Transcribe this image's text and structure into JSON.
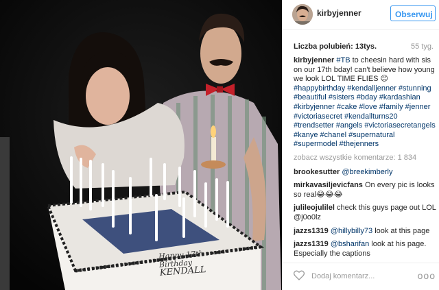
{
  "header": {
    "username": "kirbyjenner",
    "follow_label": "Obserwuj"
  },
  "meta": {
    "likes": "Liczba polubień: 13tys.",
    "age": "55 tyg."
  },
  "caption": {
    "user": "kirbyjenner",
    "hashtag_tb": "#TB",
    "text": " to cheesin hard with sis on our 17th bday! can't believe how young we look LOL TIME FLIES 😊",
    "hashtags": [
      "#happybirthday",
      "#kendalljenner",
      "#stunning",
      "#beautiful",
      "#sisters",
      "#bday",
      "#kardashian",
      "#kirbyjenner",
      "#cake",
      "#love",
      "#family",
      "#jenner",
      "#victoriasecret",
      "#kendallturns20",
      "#trendsetter",
      "#angels",
      "#victoriasecretangels",
      "#kanye",
      "#chanel",
      "#supernatural",
      "#supermodel",
      "#thejenners"
    ]
  },
  "view_all": "zobacz wszystkie komentarze: 1 834",
  "comments": [
    {
      "user": "brookesutter",
      "mention": "@breekimberly",
      "text": ""
    },
    {
      "user": "mirkavasiljevicfans",
      "mention": "",
      "text": "On every pic is looks so real😂😂😂"
    },
    {
      "user": "julileojulilel",
      "mention": "",
      "text": "check this guys page out LOL @j0o0lz"
    },
    {
      "user": "jazzs1319",
      "mention": "@hillybilly73",
      "text": " look at this page"
    },
    {
      "user": "jazzs1319",
      "mention": "@bsharifan",
      "text": " look at his page. Especially the captions"
    }
  ],
  "footer": {
    "add_comment": "Dodaj komentarz...",
    "more": "ooo"
  },
  "cake": {
    "line1": "Happy 17th",
    "line2": "Birthday",
    "line3": "KENDALL"
  },
  "colors": {
    "link": "#003569",
    "button": "#3897f0",
    "muted": "#999999"
  }
}
